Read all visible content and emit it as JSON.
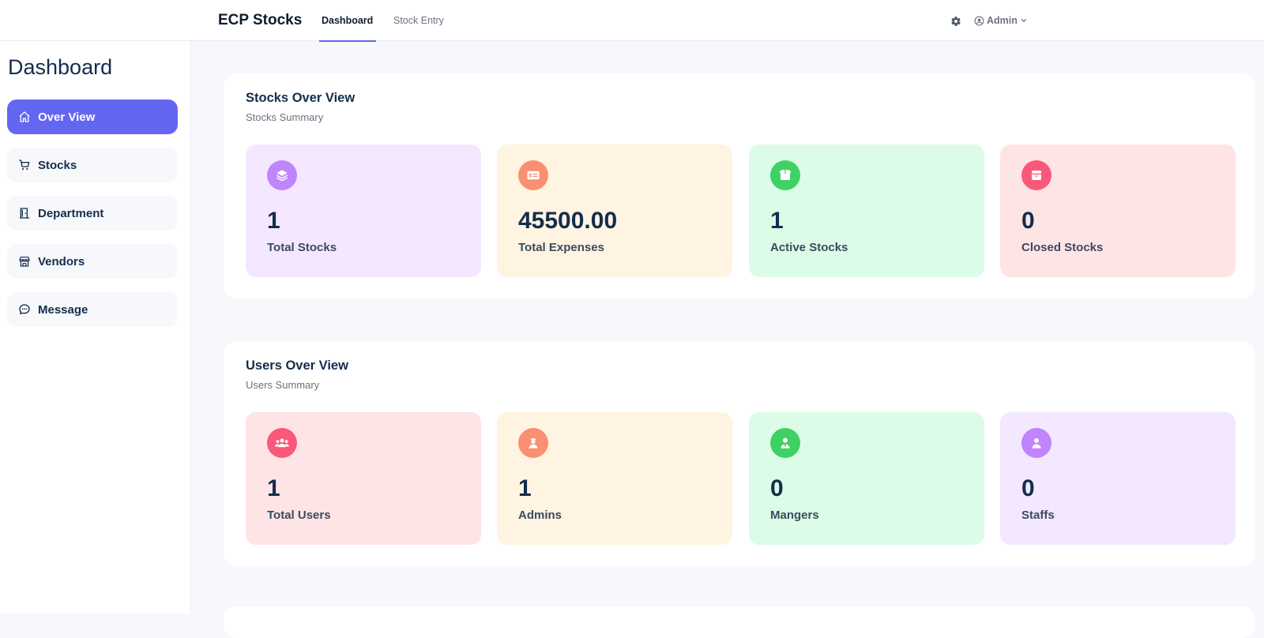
{
  "app": {
    "title": "ECP Stocks"
  },
  "nav": {
    "tabs": [
      {
        "label": "Dashboard",
        "active": true
      },
      {
        "label": "Stock Entry",
        "active": false
      }
    ],
    "settings_icon": "gear-icon",
    "user": {
      "label": "Admin",
      "icon": "user-circle-icon"
    }
  },
  "sidebar": {
    "title": "Dashboard",
    "items": [
      {
        "label": "Over View",
        "icon": "home-icon",
        "active": true
      },
      {
        "label": "Stocks",
        "icon": "cart-icon",
        "active": false
      },
      {
        "label": "Department",
        "icon": "door-icon",
        "active": false
      },
      {
        "label": "Vendors",
        "icon": "store-icon",
        "active": false
      },
      {
        "label": "Message",
        "icon": "chat-icon",
        "active": false
      }
    ]
  },
  "stocks_overview": {
    "title": "Stocks Over View",
    "subtitle": "Stocks Summary",
    "cards": [
      {
        "value": "1",
        "label": "Total Stocks",
        "icon": "layers-icon",
        "color": "#c084fc",
        "bg": "#f3e8ff"
      },
      {
        "value": "45500.00",
        "label": "Total Expenses",
        "icon": "money-icon",
        "color": "#fb8f72",
        "bg": "#fff4e1"
      },
      {
        "value": "1",
        "label": "Active Stocks",
        "icon": "open-box-icon",
        "color": "#3fd163",
        "bg": "#dcfce7"
      },
      {
        "value": "0",
        "label": "Closed Stocks",
        "icon": "closed-box-icon",
        "color": "#f9587b",
        "bg": "#ffe4e6"
      }
    ]
  },
  "users_overview": {
    "title": "Users Over View",
    "subtitle": "Users Summary",
    "cards": [
      {
        "value": "1",
        "label": "Total Users",
        "icon": "users-group-icon",
        "color": "#f9587b",
        "bg": "#ffe4e6"
      },
      {
        "value": "1",
        "label": "Admins",
        "icon": "admin-user-icon",
        "color": "#fb8f72",
        "bg": "#fff4e1"
      },
      {
        "value": "0",
        "label": "Mangers",
        "icon": "manager-user-icon",
        "color": "#3fd163",
        "bg": "#dcfce7"
      },
      {
        "value": "0",
        "label": "Staffs",
        "icon": "staff-user-icon",
        "color": "#c084fc",
        "bg": "#f3e8ff"
      }
    ]
  },
  "colors": {
    "accent": "#6366f1",
    "text_primary": "#142d4c",
    "text_muted": "#6b7280",
    "page_bg": "#f6f8fb"
  }
}
